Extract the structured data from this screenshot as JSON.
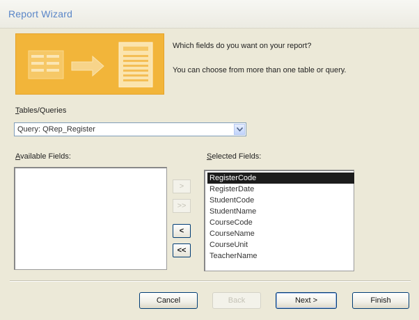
{
  "window": {
    "title": "Report Wizard"
  },
  "banner": {
    "icon": "report-wizard-banner-illustration"
  },
  "prompt": {
    "question": "Which fields do you want on your report?",
    "hint": "You can choose from more than one table or query."
  },
  "tables_queries": {
    "label_prefix": "T",
    "label_rest": "ables/Queries",
    "selected": "Query: QRep_Register"
  },
  "available_fields": {
    "label_prefix": "A",
    "label_rest": "vailable Fields:",
    "items": []
  },
  "selected_fields": {
    "label_prefix": "S",
    "label_rest": "elected Fields:",
    "items": [
      "RegisterCode",
      "RegisterDate",
      "StudentCode",
      "StudentName",
      "CourseCode",
      "CourseName",
      "CourseUnit",
      "TeacherName"
    ],
    "selected_index": 0
  },
  "move_buttons": {
    "add_one": ">",
    "add_all": ">>",
    "remove_one": "<",
    "remove_all": "<<"
  },
  "buttons": {
    "cancel": "Cancel",
    "back": "Back",
    "next": "Next >",
    "finish": "Finish"
  },
  "colors": {
    "banner": "#f2b53a",
    "title": "#5a86c8",
    "selection": "#1c1c1c"
  }
}
